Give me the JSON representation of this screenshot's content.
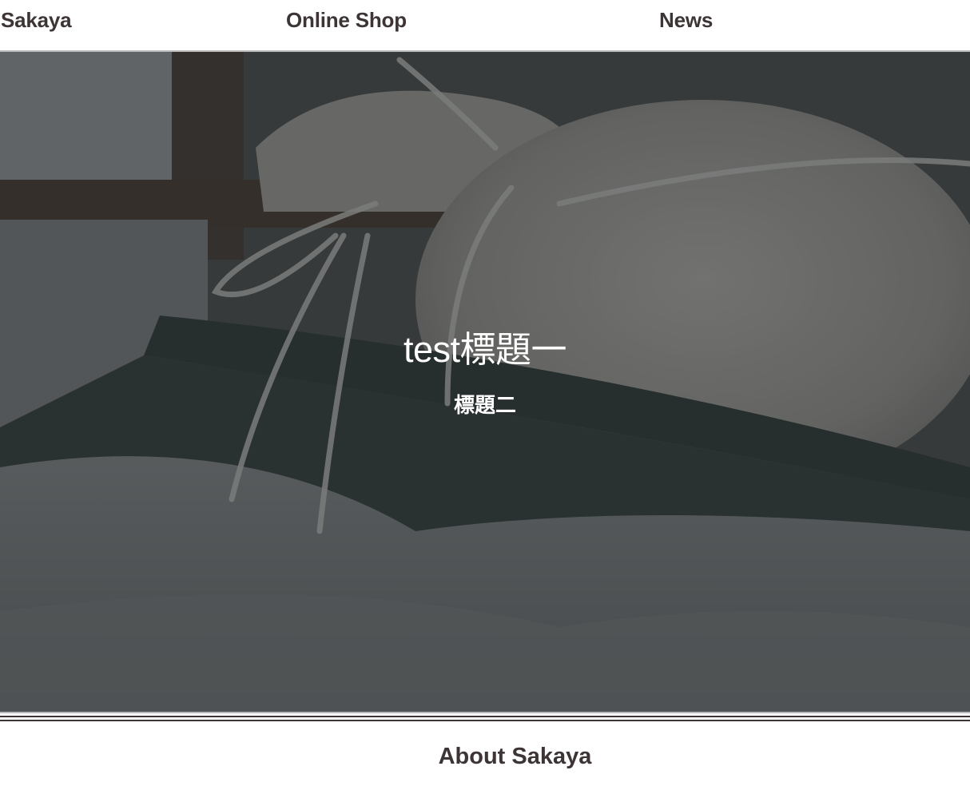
{
  "nav": {
    "brand": "Sakaya",
    "online_shop": "Online Shop",
    "news": "News"
  },
  "hero": {
    "title": "test標題一",
    "subtitle": "標題二"
  },
  "about": {
    "heading": "About Sakaya"
  },
  "colors": {
    "text": "#3d3535",
    "hero_overlay": "#2f3234",
    "hero_text": "#ffffff"
  }
}
